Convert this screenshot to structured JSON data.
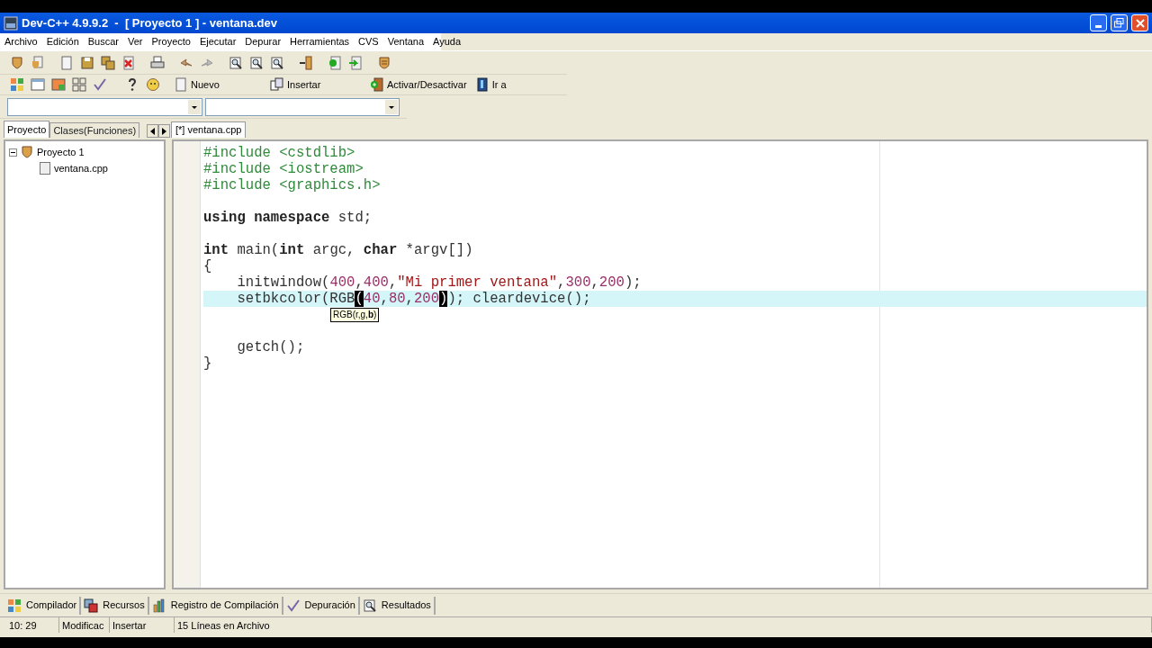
{
  "window": {
    "title": "Dev-C++ 4.9.9.2  -  [ Proyecto 1 ] - ventana.dev"
  },
  "menu": [
    "Archivo",
    "Edición",
    "Buscar",
    "Ver",
    "Proyecto",
    "Ejecutar",
    "Depurar",
    "Herramientas",
    "CVS",
    "Ventana",
    "Ayuda"
  ],
  "toolbar2_buttons": [
    {
      "label": "Nuevo",
      "kind": "page"
    },
    {
      "label": "Insertar",
      "kind": "insert"
    },
    {
      "label": "Activar/Desactivar",
      "kind": "toggle"
    },
    {
      "label": "Ir a",
      "kind": "goto"
    }
  ],
  "left_tabs": [
    {
      "label": "Proyecto",
      "selected": true
    },
    {
      "label": "Clases(Funciones)",
      "selected": false
    }
  ],
  "tree": [
    {
      "label": "Proyecto 1",
      "expanded": true,
      "children": [
        {
          "label": "ventana.cpp"
        }
      ]
    }
  ],
  "editor_tabs": [
    {
      "label": "[*] ventana.cpp",
      "selected": true
    }
  ],
  "code": [
    {
      "current": false,
      "tokens": [
        {
          "text": "#include <cstdlib>",
          "kind": "pre"
        }
      ]
    },
    {
      "current": false,
      "tokens": [
        {
          "text": "#include <iostream>",
          "kind": "pre"
        }
      ]
    },
    {
      "current": false,
      "tokens": [
        {
          "text": "#include <graphics.h>",
          "kind": "pre"
        }
      ]
    },
    {
      "current": false
    },
    {
      "current": false,
      "tokens": [
        {
          "text": "using namespace",
          "kind": "kw"
        },
        {
          "text": " std;",
          "kind": "plain"
        }
      ]
    },
    {
      "current": false
    },
    {
      "current": false,
      "tokens": [
        {
          "text": "int",
          "kind": "kw"
        },
        {
          "text": " main(",
          "kind": "plain"
        },
        {
          "text": "int",
          "kind": "kw"
        },
        {
          "text": " argc, ",
          "kind": "plain"
        },
        {
          "text": "char",
          "kind": "kw"
        },
        {
          "text": " *argv[])",
          "kind": "plain"
        }
      ]
    },
    {
      "current": false,
      "tokens": [
        {
          "text": "{",
          "kind": "plain"
        }
      ]
    },
    {
      "current": false,
      "tokens": [
        {
          "text": "    initwindow(",
          "kind": "plain"
        },
        {
          "text": "400",
          "kind": "num"
        },
        {
          "text": ",",
          "kind": "plain"
        },
        {
          "text": "400",
          "kind": "num"
        },
        {
          "text": ",",
          "kind": "plain"
        },
        {
          "text": "\"Mi primer ventana\"",
          "kind": "str"
        },
        {
          "text": ",",
          "kind": "plain"
        },
        {
          "text": "300",
          "kind": "num"
        },
        {
          "text": ",",
          "kind": "plain"
        },
        {
          "text": "200",
          "kind": "num"
        },
        {
          "text": ");",
          "kind": "plain"
        }
      ]
    },
    {
      "current": true,
      "tokens": [
        {
          "text": "    setbkcolor(RGB",
          "kind": "plain"
        },
        {
          "text": "(",
          "kind": "match"
        },
        {
          "text": "40",
          "kind": "num"
        },
        {
          "text": ",",
          "kind": "plain"
        },
        {
          "text": "80",
          "kind": "num"
        },
        {
          "text": ",",
          "kind": "plain"
        },
        {
          "text": "200",
          "kind": "num"
        },
        {
          "text": ")",
          "kind": "match"
        },
        {
          "text": "); cleardevice();",
          "kind": "plain"
        }
      ],
      "calltip": "RGB(r,g,**b**)"
    },
    {
      "current": false
    },
    {
      "current": false
    },
    {
      "current": false,
      "tokens": [
        {
          "text": "    getch();",
          "kind": "plain"
        }
      ]
    },
    {
      "current": false,
      "tokens": [
        {
          "text": "}",
          "kind": "plain"
        }
      ]
    }
  ],
  "bottom_tabs": [
    {
      "label": "Compilador",
      "kind": "grid"
    },
    {
      "label": "Recursos",
      "kind": "resources"
    },
    {
      "label": "Registro de Compilación",
      "kind": "chart"
    },
    {
      "label": "Depuración",
      "kind": "check"
    },
    {
      "label": "Resultados",
      "kind": "search"
    }
  ],
  "status_bar": [
    "10: 29",
    "Modificac",
    "Insertar",
    "15 Líneas en Archivo"
  ]
}
